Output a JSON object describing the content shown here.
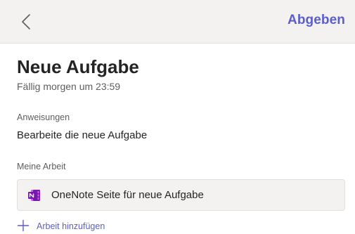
{
  "header": {
    "back_icon": "chevron-left-icon",
    "submit_label": "Abgeben",
    "accent_color": "#5b5fc7"
  },
  "assignment": {
    "title": "Neue Aufgabe",
    "due": "Fällig morgen um 23:59"
  },
  "instructions": {
    "label": "Anweisungen",
    "text": "Bearbeite die neue Aufgabe"
  },
  "my_work": {
    "label": "Meine Arbeit",
    "items": [
      {
        "icon": "onenote-icon",
        "label": "OneNote Seite für neue Aufgabe"
      }
    ],
    "add_icon": "plus-icon",
    "add_label": "Arbeit hinzufügen"
  }
}
